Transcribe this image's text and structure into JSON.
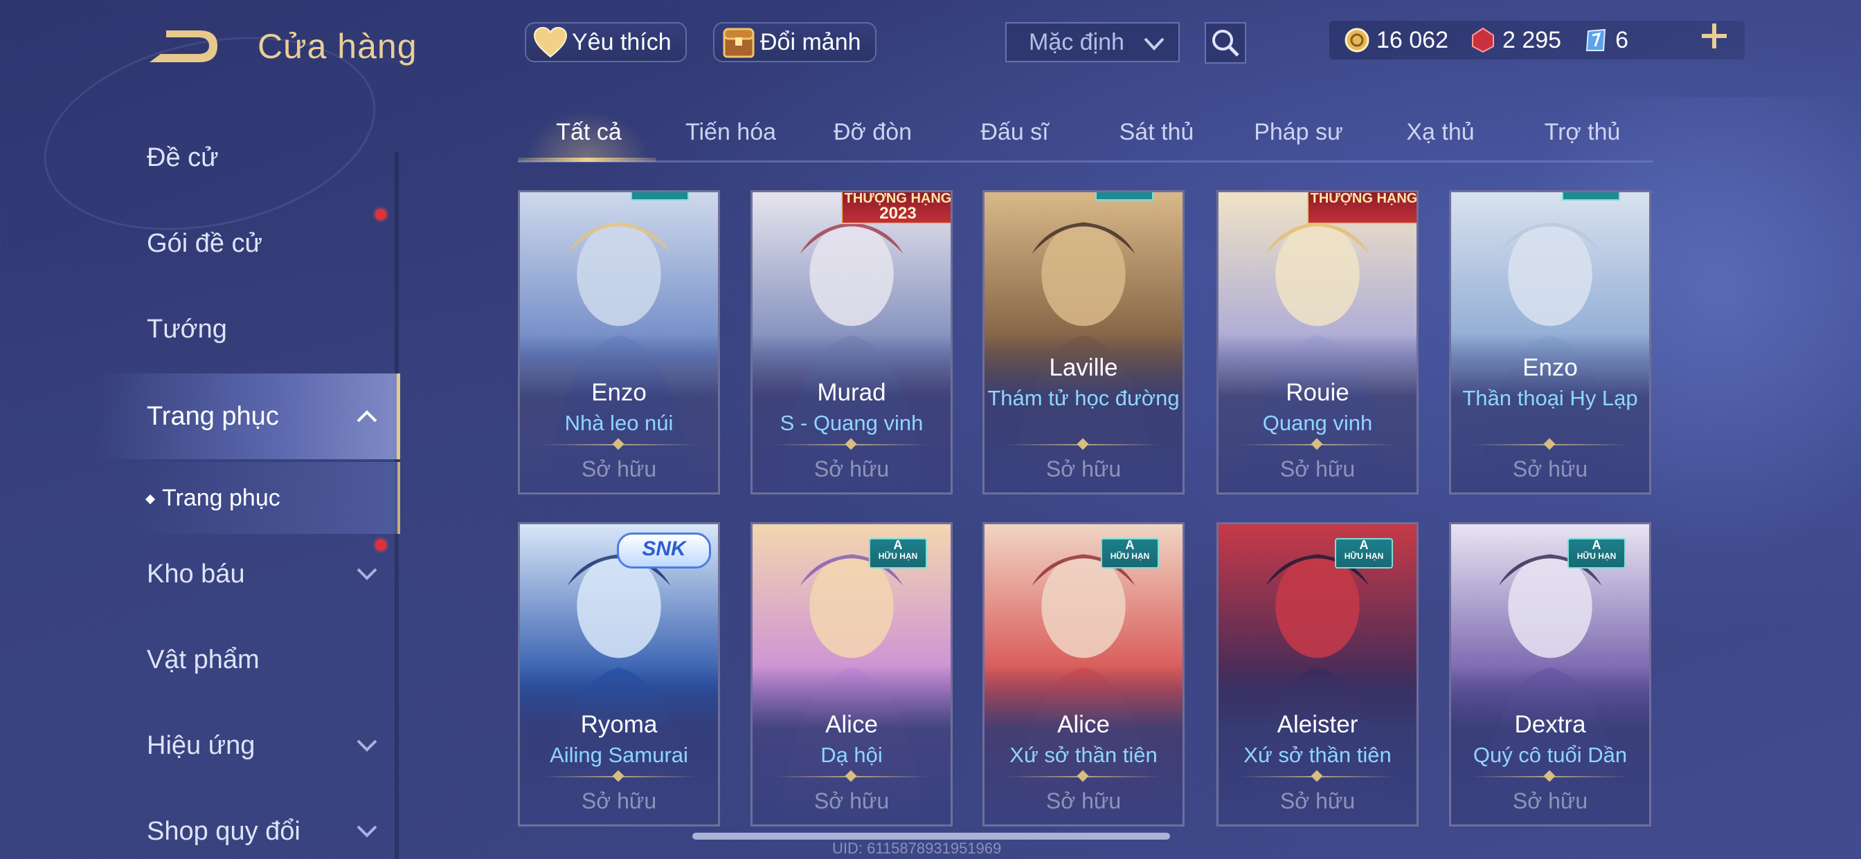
{
  "header": {
    "title": "Cửa hàng",
    "favorite_label": "Yêu thích",
    "fragment_label": "Đổi mảnh",
    "sort_value": "Mặc định"
  },
  "currencies": [
    {
      "icon": "gold-coin-icon",
      "value": "16 062"
    },
    {
      "icon": "red-voucher-icon",
      "value": "2 295"
    },
    {
      "icon": "blue-ticket-icon",
      "value": "6"
    }
  ],
  "sidebar": {
    "items": [
      {
        "label": "Đề cử"
      },
      {
        "label": "Gói đề cử"
      },
      {
        "label": "Tướng"
      },
      {
        "label": "Trang phục"
      },
      {
        "label": "Kho báu"
      },
      {
        "label": "Vật phẩm"
      },
      {
        "label": "Hiệu ứng"
      },
      {
        "label": "Shop quy đổi"
      }
    ],
    "sub_item": "Trang phục"
  },
  "tabs": [
    "Tất cả",
    "Tiến hóa",
    "Đỡ đòn",
    "Đấu sĩ",
    "Sát thủ",
    "Pháp sư",
    "Xạ thủ",
    "Trợ thủ"
  ],
  "cards": [
    {
      "hero": "Enzo",
      "skin": "Nhà leo núi",
      "status": "Sở hữu",
      "palette": [
        "#cfd9ec",
        "#6a86c4",
        "#e7c27a"
      ]
    },
    {
      "hero": "Murad",
      "skin": "S - Quang vinh",
      "status": "Sở hữu",
      "badge": "THƯỢNG HẠNG",
      "badge_year": "2023",
      "palette": [
        "#e6e4ee",
        "#7a88b8",
        "#9c3a48"
      ]
    },
    {
      "hero": "Laville",
      "skin": "Thám tử học đường",
      "status": "Sở hữu",
      "palette": [
        "#d9b889",
        "#7b5a3e",
        "#3b2a22"
      ]
    },
    {
      "hero": "Rouie",
      "skin": "Quang vinh",
      "status": "Sở hữu",
      "badge": "THƯỢNG HẠNG",
      "palette": [
        "#f0e3c6",
        "#a6a6d8",
        "#e5bd6c"
      ]
    },
    {
      "hero": "Enzo",
      "skin": "Thần thoại Hy Lạp",
      "status": "Sở hữu",
      "palette": [
        "#d9e2ef",
        "#8aa7d2",
        "#b9c7db"
      ]
    },
    {
      "hero": "Ryoma",
      "skin": "Ailing Samurai",
      "status": "Sở hữu",
      "badge": "SNK",
      "palette": [
        "#d8e6f8",
        "#2753a8",
        "#142a6a"
      ]
    },
    {
      "hero": "Alice",
      "skin": "Dạ hội",
      "status": "Sở hữu",
      "badge_limit": "HỮU HẠN",
      "badge_limit_grade": "A",
      "palette": [
        "#f3d6b0",
        "#c98ad9",
        "#7d5ab0"
      ]
    },
    {
      "hero": "Alice",
      "skin": "Xứ sở thần tiên",
      "status": "Sở hữu",
      "badge_limit": "HỮU HẠN",
      "badge_limit_grade": "A",
      "palette": [
        "#f0d5c4",
        "#d54b4b",
        "#8c2a32"
      ]
    },
    {
      "hero": "Aleister",
      "skin": "Xứ sở thần tiên",
      "status": "Sở hữu",
      "badge_limit": "HỮU HẠN",
      "badge_limit_grade": "A",
      "palette": [
        "#c73a48",
        "#3c2a5a",
        "#1c1836"
      ]
    },
    {
      "hero": "Dextra",
      "skin": "Quý cô tuổi Dần",
      "status": "Sở hữu",
      "badge_limit": "HỮU HẠN",
      "badge_limit_grade": "A",
      "palette": [
        "#e8e4f2",
        "#6e5aa8",
        "#2c2450"
      ]
    }
  ],
  "uid": "UID: 6115878931951969"
}
